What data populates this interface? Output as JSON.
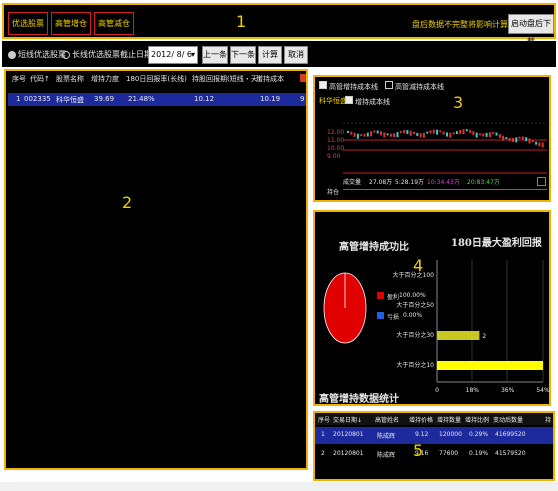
{
  "toolbar": {
    "btn1": "优选股票池",
    "btn2": "高管增仓池",
    "btn3": "高管减仓池",
    "region_label": "1",
    "notice": "盘后数据不完整将影响计算结果",
    "start_btn": "启动盘后下载"
  },
  "filter": {
    "radio1": "短线优选股票",
    "radio2": "长线优选股票",
    "date_label": "截止日期",
    "date_value": "2012/ 8/ 6",
    "prev_btn": "上一条",
    "next_btn": "下一条",
    "calc_btn": "计算",
    "cancel_btn": "取消"
  },
  "stock_table": {
    "region_label": "2",
    "headers": [
      "序号",
      "代码↑",
      "股票名称",
      "增持力度",
      "180日回报率(长线)",
      "持股回报期(短线・天)",
      "增持成本"
    ],
    "rows": [
      {
        "no": "1",
        "code": "002335",
        "name": "科华恒盛",
        "strength": "39.69",
        "ret180": "21.48%",
        "hold": "10.12",
        "cost": "10.19",
        "extra": "9"
      }
    ]
  },
  "kchart": {
    "region_label": "3",
    "check1": "高管增持成本线",
    "check2": "高管减持成本线",
    "stock_name": "科华恒盛",
    "check3": "增持成本线",
    "y_ticks": [
      "12.00",
      "11.00",
      "10.00",
      "9.00"
    ],
    "volume_label": "成交量",
    "vol1": "27.08万",
    "vol2": "5:28.19万",
    "vol3": "10:34.43万",
    "vol4": "20:83.47万",
    "indicator_label": "持仓"
  },
  "stats": {
    "region_label": "4",
    "title_left": "高管增持成功比",
    "title_right": "180日最大盈利回报",
    "legend": [
      {
        "label": "盈利",
        "value": "100.00%",
        "color": "#e00000"
      },
      {
        "label": "亏损",
        "value": "0.00%",
        "color": "#2060e0"
      }
    ],
    "footer": "高管增持数据统计",
    "bar_labels": [
      "大于百分之100",
      "大于百分之50",
      "大于百分之30",
      "大于百分之10"
    ],
    "x_ticks": [
      "0",
      "18%",
      "36%",
      "54%"
    ]
  },
  "chart_data": {
    "type": "bar",
    "categories": [
      "大于百分之100",
      "大于百分之50",
      "大于百分之30",
      "大于百分之10"
    ],
    "values": [
      0,
      0,
      2,
      5
    ],
    "data_labels": [
      "",
      "",
      "2",
      ""
    ],
    "colors": [
      "#d0d000",
      "#d0d000",
      "#c8c820",
      "#ffff00"
    ]
  },
  "trades": {
    "region_label": "5",
    "headers": [
      "序号",
      "交易日期↓",
      "高管姓名",
      "增持价格",
      "增持数量",
      "增持比例",
      "变动后数量",
      "持"
    ],
    "rows": [
      {
        "no": "1",
        "date": "20120801",
        "name": "陈成辉",
        "price": "9.12",
        "qty": "120000",
        "ratio": "0.29%",
        "after": "41699520"
      },
      {
        "no": "2",
        "date": "20120801",
        "name": "陈成辉",
        "price": "9.16",
        "qty": "77600",
        "ratio": "0.19%",
        "after": "41579520"
      }
    ]
  }
}
